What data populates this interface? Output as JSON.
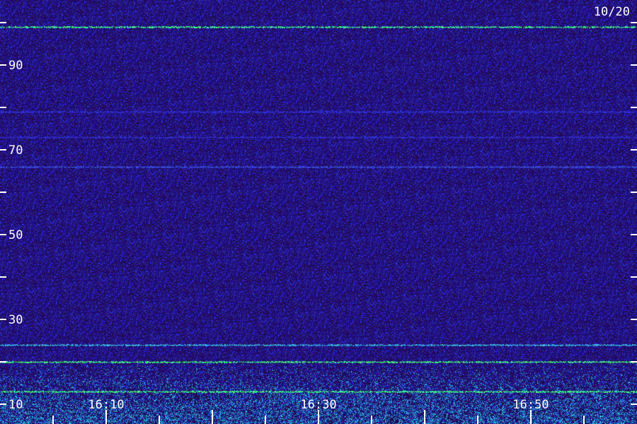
{
  "chart_data": {
    "type": "heatmap",
    "title": "",
    "xlabel": "",
    "ylabel": "",
    "date_label": "10/20",
    "x_tick_labels": [
      "16:10",
      "16:30",
      "16:50"
    ],
    "y_tick_labels": [
      "10",
      "30",
      "50",
      "70",
      "90"
    ],
    "y_tick_values": [
      10,
      30,
      50,
      70,
      90
    ],
    "ylim": [
      10,
      100
    ],
    "colors": {
      "background": "#1a0a4a",
      "low": "#22108a",
      "mid": "#2a36d8",
      "high": "#38e0e8",
      "peak": "#40ff80",
      "text": "#ffffff"
    },
    "bands": [
      {
        "y": 99,
        "color": "#40ff90"
      },
      {
        "y": 79,
        "color": "#3030d8"
      },
      {
        "y": 73,
        "color": "#3030d0"
      },
      {
        "y": 66,
        "color": "#3a50e0"
      },
      {
        "y": 24,
        "color": "#38c0e8"
      },
      {
        "y": 20,
        "color": "#40ff80"
      },
      {
        "y": 13,
        "color": "#40ff80"
      }
    ]
  }
}
